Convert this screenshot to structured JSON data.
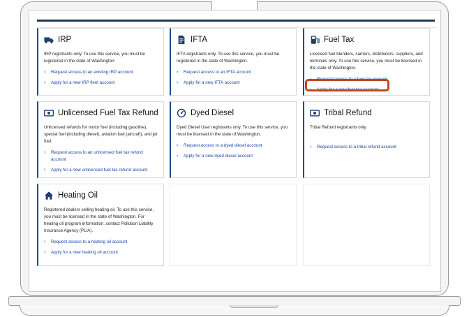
{
  "cards": [
    {
      "title": "IRP",
      "icon": "truck-icon",
      "desc": "IRP registrants only. To use this service, you must be registered in the state of Washington.",
      "links": [
        "Request access to an existing IRP account",
        "Apply for a new IRP fleet account"
      ]
    },
    {
      "title": "IFTA",
      "icon": "document-icon",
      "desc": "IFTA registrants only. To use this service, you must be registered in the state of Washington.",
      "links": [
        "Request access to an IFTA account",
        "Apply for a new IFTA account"
      ]
    },
    {
      "title": "Fuel Tax",
      "icon": "fuel-pump-icon",
      "desc": "Licensed fuel blenders, carriers, distributors, suppliers, and terminals only. To use this service, you must be licensed in the state of Washington.",
      "links": [
        "Request access to a fuel tax account",
        "Apply for a new fuel tax account"
      ]
    },
    {
      "title": "Unlicensed Fuel Tax Refund",
      "icon": "money-icon",
      "desc": "Unlicensed refunds for motor fuel (including gasoline), special fuel (including diesel), aviation fuel (aircraft), and jet fuel.",
      "links": [
        "Request access to an unlicensed fuel tax refund account",
        "Apply for a new unlicensed fuel tax refund account"
      ]
    },
    {
      "title": "Dyed Diesel",
      "icon": "gauge-icon",
      "desc": "Dyed Diesel User registrants only. To use this service, you must be licensed in the state of Washington.",
      "links": [
        "Request access to a dyed diesel account",
        "Apply for a new dyed diesel account"
      ]
    },
    {
      "title": "Tribal Refund",
      "icon": "money-icon",
      "desc": "Tribal Refund registrants only.",
      "links": [
        "Request access to a tribal refund account"
      ]
    },
    {
      "title": "Heating Oil",
      "icon": "home-icon",
      "desc": "Registered dealers selling heating oil. To use this service, you must be licensed in the state of Washington. For heating oil program information, contact Pollution Liability Insurance Agency (PLIA).",
      "links": [
        "Request access to a heating oil account",
        "Apply for a new heating oil account"
      ]
    }
  ],
  "colors": {
    "accent": "#1e4a8c",
    "link": "#1a4aa8",
    "highlight": "#c0461c",
    "topbar": "#1e3553"
  },
  "highlighted_link": "Apply for a new fuel tax account"
}
